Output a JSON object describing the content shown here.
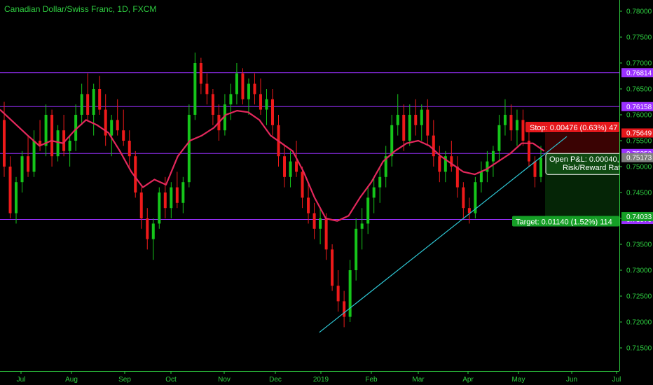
{
  "chart_data": {
    "type": "candlestick",
    "title": "Canadian Dollar/Swiss Franc, 1D, FXCM",
    "ylim": [
      0.712,
      0.7815
    ],
    "y_ticks": [
      "0.78000",
      "0.77500",
      "0.77000",
      "0.76500",
      "0.76000",
      "0.75500",
      "0.75000",
      "0.74500",
      "0.74000",
      "0.73500",
      "0.73000",
      "0.72500",
      "0.72000",
      "0.71500"
    ],
    "x_labels": [
      "Jul",
      "Aug",
      "Sep",
      "Oct",
      "Nov",
      "Dec",
      "2019",
      "Feb",
      "Mar",
      "Apr",
      "May",
      "Jun",
      "Jul"
    ],
    "grid": false,
    "colors": {
      "up": "#15c51a",
      "down": "#ee1a1a",
      "ma": "#e3285c",
      "trend": "#2ec8d6",
      "level": "#9b30ff",
      "axis": "#2ecc40",
      "stop": "#e5171b",
      "target": "#159f26",
      "current": "#7f7f7f"
    },
    "horizontal_levels": [
      {
        "price": 0.76814,
        "label": "0.76814"
      },
      {
        "price": 0.76158,
        "label": "0.76158"
      },
      {
        "price": 0.75253,
        "label": "0.75253"
      },
      {
        "price": 0.73979,
        "label": "0.73979"
      }
    ],
    "price_tags": [
      {
        "price": 0.75649,
        "label": "0.75649",
        "kind": "stop"
      },
      {
        "price": 0.75173,
        "label": "0.75173",
        "kind": "current"
      },
      {
        "price": 0.74033,
        "label": "0.74033",
        "kind": "target"
      }
    ],
    "moving_average": [
      {
        "x": "2018-06-29",
        "y": 0.761
      },
      {
        "x": "2018-07-06",
        "y": 0.756
      },
      {
        "x": "2018-07-13",
        "y": 0.754
      },
      {
        "x": "2018-07-20",
        "y": 0.755
      },
      {
        "x": "2018-07-27",
        "y": 0.7545
      },
      {
        "x": "2018-08-03",
        "y": 0.757
      },
      {
        "x": "2018-08-10",
        "y": 0.759
      },
      {
        "x": "2018-08-17",
        "y": 0.758
      },
      {
        "x": "2018-08-24",
        "y": 0.7565
      },
      {
        "x": "2018-08-31",
        "y": 0.753
      },
      {
        "x": "2018-09-07",
        "y": 0.749
      },
      {
        "x": "2018-09-14",
        "y": 0.746
      },
      {
        "x": "2018-09-21",
        "y": 0.7475
      },
      {
        "x": "2018-09-28",
        "y": 0.7465
      },
      {
        "x": "2018-10-05",
        "y": 0.752
      },
      {
        "x": "2018-10-12",
        "y": 0.755
      },
      {
        "x": "2018-10-19",
        "y": 0.756
      },
      {
        "x": "2018-10-26",
        "y": 0.7575
      },
      {
        "x": "2018-11-02",
        "y": 0.76
      },
      {
        "x": "2018-11-09",
        "y": 0.7608
      },
      {
        "x": "2018-11-16",
        "y": 0.7605
      },
      {
        "x": "2018-11-23",
        "y": 0.759
      },
      {
        "x": "2018-11-30",
        "y": 0.756
      },
      {
        "x": "2018-12-07",
        "y": 0.7545
      },
      {
        "x": "2018-12-14",
        "y": 0.753
      },
      {
        "x": "2018-12-21",
        "y": 0.749
      },
      {
        "x": "2018-12-28",
        "y": 0.744
      },
      {
        "x": "2019-01-04",
        "y": 0.74
      },
      {
        "x": "2019-01-11",
        "y": 0.7395
      },
      {
        "x": "2019-01-18",
        "y": 0.7405
      },
      {
        "x": "2019-01-25",
        "y": 0.744
      },
      {
        "x": "2019-02-01",
        "y": 0.747
      },
      {
        "x": "2019-02-08",
        "y": 0.751
      },
      {
        "x": "2019-02-15",
        "y": 0.753
      },
      {
        "x": "2019-02-22",
        "y": 0.7545
      },
      {
        "x": "2019-03-01",
        "y": 0.755
      },
      {
        "x": "2019-03-08",
        "y": 0.754
      },
      {
        "x": "2019-03-15",
        "y": 0.752
      },
      {
        "x": "2019-03-22",
        "y": 0.7505
      },
      {
        "x": "2019-03-29",
        "y": 0.749
      },
      {
        "x": "2019-04-05",
        "y": 0.7485
      },
      {
        "x": "2019-04-12",
        "y": 0.7495
      },
      {
        "x": "2019-04-19",
        "y": 0.751
      },
      {
        "x": "2019-04-26",
        "y": 0.7525
      },
      {
        "x": "2019-05-03",
        "y": 0.7545
      },
      {
        "x": "2019-05-10",
        "y": 0.7545
      },
      {
        "x": "2019-05-17",
        "y": 0.753
      }
    ],
    "trendline": [
      {
        "x": "2018-12-31",
        "y": 0.718
      },
      {
        "x": "2019-05-31",
        "y": 0.7558
      }
    ],
    "position": {
      "entry": 0.75173,
      "stop": 0.75649,
      "target": 0.74033,
      "stop_label": "Stop: 0.00476 (0.63%) 47",
      "target_label": "Target: 0.01140 (1.52%) 114",
      "pnl_label": "Open P&L: 0.00040,",
      "rr_label": "Risk/Reward Rat"
    },
    "candles": [
      {
        "o": 0.759,
        "h": 0.7625,
        "l": 0.748,
        "c": 0.75
      },
      {
        "o": 0.75,
        "h": 0.752,
        "l": 0.74,
        "c": 0.741
      },
      {
        "o": 0.741,
        "h": 0.748,
        "l": 0.739,
        "c": 0.747
      },
      {
        "o": 0.747,
        "h": 0.753,
        "l": 0.745,
        "c": 0.752
      },
      {
        "o": 0.752,
        "h": 0.756,
        "l": 0.748,
        "c": 0.749
      },
      {
        "o": 0.749,
        "h": 0.757,
        "l": 0.748,
        "c": 0.755
      },
      {
        "o": 0.755,
        "h": 0.759,
        "l": 0.753,
        "c": 0.754
      },
      {
        "o": 0.754,
        "h": 0.762,
        "l": 0.752,
        "c": 0.76
      },
      {
        "o": 0.76,
        "h": 0.761,
        "l": 0.75,
        "c": 0.752
      },
      {
        "o": 0.752,
        "h": 0.758,
        "l": 0.751,
        "c": 0.757
      },
      {
        "o": 0.757,
        "h": 0.76,
        "l": 0.752,
        "c": 0.753
      },
      {
        "o": 0.753,
        "h": 0.756,
        "l": 0.75,
        "c": 0.755
      },
      {
        "o": 0.755,
        "h": 0.762,
        "l": 0.753,
        "c": 0.76
      },
      {
        "o": 0.76,
        "h": 0.766,
        "l": 0.758,
        "c": 0.764
      },
      {
        "o": 0.764,
        "h": 0.768,
        "l": 0.759,
        "c": 0.76
      },
      {
        "o": 0.76,
        "h": 0.766,
        "l": 0.756,
        "c": 0.765
      },
      {
        "o": 0.765,
        "h": 0.7675,
        "l": 0.76,
        "c": 0.761
      },
      {
        "o": 0.761,
        "h": 0.764,
        "l": 0.754,
        "c": 0.756
      },
      {
        "o": 0.756,
        "h": 0.76,
        "l": 0.752,
        "c": 0.759
      },
      {
        "o": 0.759,
        "h": 0.763,
        "l": 0.756,
        "c": 0.757
      },
      {
        "o": 0.757,
        "h": 0.761,
        "l": 0.754,
        "c": 0.755
      },
      {
        "o": 0.755,
        "h": 0.757,
        "l": 0.75,
        "c": 0.752
      },
      {
        "o": 0.752,
        "h": 0.753,
        "l": 0.744,
        "c": 0.745
      },
      {
        "o": 0.745,
        "h": 0.746,
        "l": 0.738,
        "c": 0.74
      },
      {
        "o": 0.74,
        "h": 0.742,
        "l": 0.734,
        "c": 0.736
      },
      {
        "o": 0.736,
        "h": 0.74,
        "l": 0.732,
        "c": 0.739
      },
      {
        "o": 0.739,
        "h": 0.746,
        "l": 0.738,
        "c": 0.745
      },
      {
        "o": 0.745,
        "h": 0.748,
        "l": 0.74,
        "c": 0.742
      },
      {
        "o": 0.742,
        "h": 0.747,
        "l": 0.74,
        "c": 0.746
      },
      {
        "o": 0.746,
        "h": 0.749,
        "l": 0.742,
        "c": 0.743
      },
      {
        "o": 0.743,
        "h": 0.748,
        "l": 0.741,
        "c": 0.747
      },
      {
        "o": 0.747,
        "h": 0.762,
        "l": 0.746,
        "c": 0.76
      },
      {
        "o": 0.76,
        "h": 0.772,
        "l": 0.759,
        "c": 0.77
      },
      {
        "o": 0.77,
        "h": 0.771,
        "l": 0.764,
        "c": 0.766
      },
      {
        "o": 0.766,
        "h": 0.768,
        "l": 0.762,
        "c": 0.764
      },
      {
        "o": 0.764,
        "h": 0.765,
        "l": 0.758,
        "c": 0.76
      },
      {
        "o": 0.76,
        "h": 0.762,
        "l": 0.755,
        "c": 0.757
      },
      {
        "o": 0.757,
        "h": 0.764,
        "l": 0.756,
        "c": 0.762
      },
      {
        "o": 0.762,
        "h": 0.766,
        "l": 0.759,
        "c": 0.764
      },
      {
        "o": 0.764,
        "h": 0.77,
        "l": 0.762,
        "c": 0.768
      },
      {
        "o": 0.768,
        "h": 0.769,
        "l": 0.762,
        "c": 0.763
      },
      {
        "o": 0.763,
        "h": 0.767,
        "l": 0.76,
        "c": 0.766
      },
      {
        "o": 0.766,
        "h": 0.768,
        "l": 0.762,
        "c": 0.764
      },
      {
        "o": 0.764,
        "h": 0.767,
        "l": 0.76,
        "c": 0.761
      },
      {
        "o": 0.761,
        "h": 0.765,
        "l": 0.758,
        "c": 0.763
      },
      {
        "o": 0.763,
        "h": 0.765,
        "l": 0.756,
        "c": 0.758
      },
      {
        "o": 0.758,
        "h": 0.76,
        "l": 0.75,
        "c": 0.752
      },
      {
        "o": 0.752,
        "h": 0.754,
        "l": 0.746,
        "c": 0.748
      },
      {
        "o": 0.748,
        "h": 0.753,
        "l": 0.746,
        "c": 0.751
      },
      {
        "o": 0.751,
        "h": 0.755,
        "l": 0.748,
        "c": 0.749
      },
      {
        "o": 0.749,
        "h": 0.75,
        "l": 0.742,
        "c": 0.744
      },
      {
        "o": 0.744,
        "h": 0.747,
        "l": 0.739,
        "c": 0.741
      },
      {
        "o": 0.741,
        "h": 0.743,
        "l": 0.736,
        "c": 0.738
      },
      {
        "o": 0.738,
        "h": 0.742,
        "l": 0.735,
        "c": 0.74
      },
      {
        "o": 0.74,
        "h": 0.741,
        "l": 0.732,
        "c": 0.734
      },
      {
        "o": 0.734,
        "h": 0.735,
        "l": 0.726,
        "c": 0.727
      },
      {
        "o": 0.727,
        "h": 0.73,
        "l": 0.722,
        "c": 0.724
      },
      {
        "o": 0.724,
        "h": 0.726,
        "l": 0.719,
        "c": 0.721
      },
      {
        "o": 0.721,
        "h": 0.732,
        "l": 0.72,
        "c": 0.73
      },
      {
        "o": 0.73,
        "h": 0.74,
        "l": 0.728,
        "c": 0.738
      },
      {
        "o": 0.738,
        "h": 0.742,
        "l": 0.734,
        "c": 0.739
      },
      {
        "o": 0.739,
        "h": 0.746,
        "l": 0.737,
        "c": 0.744
      },
      {
        "o": 0.744,
        "h": 0.748,
        "l": 0.741,
        "c": 0.746
      },
      {
        "o": 0.746,
        "h": 0.75,
        "l": 0.743,
        "c": 0.748
      },
      {
        "o": 0.748,
        "h": 0.754,
        "l": 0.746,
        "c": 0.752
      },
      {
        "o": 0.752,
        "h": 0.76,
        "l": 0.75,
        "c": 0.758
      },
      {
        "o": 0.758,
        "h": 0.764,
        "l": 0.756,
        "c": 0.76
      },
      {
        "o": 0.76,
        "h": 0.762,
        "l": 0.753,
        "c": 0.755
      },
      {
        "o": 0.755,
        "h": 0.762,
        "l": 0.754,
        "c": 0.76
      },
      {
        "o": 0.76,
        "h": 0.763,
        "l": 0.756,
        "c": 0.758
      },
      {
        "o": 0.758,
        "h": 0.762,
        "l": 0.755,
        "c": 0.761
      },
      {
        "o": 0.761,
        "h": 0.763,
        "l": 0.754,
        "c": 0.756
      },
      {
        "o": 0.756,
        "h": 0.759,
        "l": 0.75,
        "c": 0.752
      },
      {
        "o": 0.752,
        "h": 0.754,
        "l": 0.747,
        "c": 0.749
      },
      {
        "o": 0.749,
        "h": 0.753,
        "l": 0.747,
        "c": 0.752
      },
      {
        "o": 0.752,
        "h": 0.755,
        "l": 0.749,
        "c": 0.75
      },
      {
        "o": 0.75,
        "h": 0.752,
        "l": 0.744,
        "c": 0.746
      },
      {
        "o": 0.746,
        "h": 0.747,
        "l": 0.74,
        "c": 0.742
      },
      {
        "o": 0.742,
        "h": 0.744,
        "l": 0.739,
        "c": 0.741
      },
      {
        "o": 0.741,
        "h": 0.748,
        "l": 0.74,
        "c": 0.747
      },
      {
        "o": 0.747,
        "h": 0.751,
        "l": 0.745,
        "c": 0.749
      },
      {
        "o": 0.749,
        "h": 0.753,
        "l": 0.747,
        "c": 0.751
      },
      {
        "o": 0.751,
        "h": 0.754,
        "l": 0.748,
        "c": 0.753
      },
      {
        "o": 0.753,
        "h": 0.76,
        "l": 0.751,
        "c": 0.758
      },
      {
        "o": 0.758,
        "h": 0.763,
        "l": 0.756,
        "c": 0.76
      },
      {
        "o": 0.76,
        "h": 0.762,
        "l": 0.755,
        "c": 0.757
      },
      {
        "o": 0.757,
        "h": 0.761,
        "l": 0.754,
        "c": 0.759
      },
      {
        "o": 0.759,
        "h": 0.761,
        "l": 0.754,
        "c": 0.755
      },
      {
        "o": 0.755,
        "h": 0.757,
        "l": 0.75,
        "c": 0.751
      },
      {
        "o": 0.751,
        "h": 0.752,
        "l": 0.746,
        "c": 0.748
      },
      {
        "o": 0.748,
        "h": 0.754,
        "l": 0.747,
        "c": 0.7517
      }
    ]
  }
}
